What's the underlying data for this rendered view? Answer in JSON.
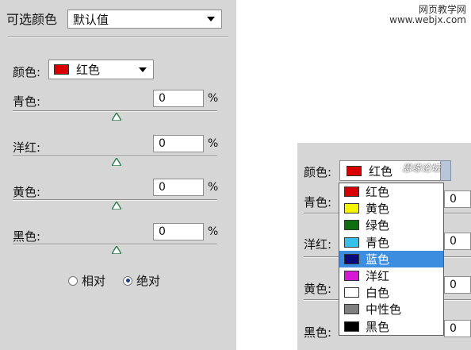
{
  "left_panel": {
    "title": "可选颜色",
    "preset_value": "默认值",
    "color_label": "颜色:",
    "color_value": "红色",
    "color_swatch": "#d80000",
    "params": [
      {
        "label": "青色:",
        "value": "0",
        "unit": "%"
      },
      {
        "label": "洋红:",
        "value": "0",
        "unit": "%"
      },
      {
        "label": "黄色:",
        "value": "0",
        "unit": "%"
      },
      {
        "label": "黑色:",
        "value": "0",
        "unit": "%"
      }
    ],
    "radio": {
      "relative": "相对",
      "absolute": "绝对",
      "selected": "absolute"
    }
  },
  "right_panel": {
    "watermark_line1": "网页教学网",
    "watermark_line2": "www.webjx.com",
    "badge": "思缘论坛",
    "color_label": "颜色:",
    "color_value": "红色",
    "color_swatch": "#d80000",
    "param_labels": [
      "青色:",
      "洋红:",
      "黄色:",
      "黑色:"
    ],
    "param_values": [
      "0",
      "0",
      "0",
      "0"
    ],
    "dropdown_items": [
      {
        "label": "红色",
        "swatch": "#d80000"
      },
      {
        "label": "黄色",
        "swatch": "#f5f500"
      },
      {
        "label": "绿色",
        "swatch": "#0f6e0f"
      },
      {
        "label": "青色",
        "swatch": "#39c0e8"
      },
      {
        "label": "蓝色",
        "swatch": "#0a0a7a",
        "selected": true
      },
      {
        "label": "洋红",
        "swatch": "#d618d6"
      },
      {
        "label": "白色",
        "swatch": "#ffffff"
      },
      {
        "label": "中性色",
        "swatch": "#808080"
      },
      {
        "label": "黑色",
        "swatch": "#000000"
      }
    ]
  },
  "colors": {
    "panel_bg": "#d6d6d6",
    "selection": "#3c8de0"
  }
}
